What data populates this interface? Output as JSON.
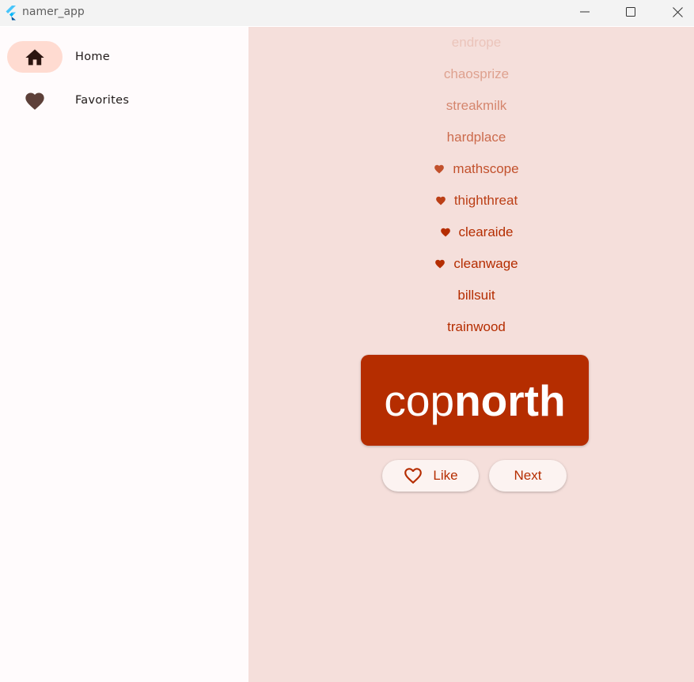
{
  "window": {
    "title": "namer_app",
    "icons": {
      "logo": "flutter-logo-icon",
      "minimize": "minimize-icon",
      "maximize": "maximize-icon",
      "close": "close-icon"
    }
  },
  "sidebar": {
    "items": [
      {
        "label": "Home",
        "icon": "home-icon",
        "selected": true
      },
      {
        "label": "Favorites",
        "icon": "heart-icon",
        "selected": false
      }
    ]
  },
  "history": [
    {
      "word": "endrope",
      "favorite": false
    },
    {
      "word": "chaosprize",
      "favorite": false
    },
    {
      "word": "streakmilk",
      "favorite": false
    },
    {
      "word": "hardplace",
      "favorite": false
    },
    {
      "word": "mathscope",
      "favorite": true
    },
    {
      "word": "thighthreat",
      "favorite": true
    },
    {
      "word": "clearaide",
      "favorite": true
    },
    {
      "word": "cleanwage",
      "favorite": true
    },
    {
      "word": "billsuit",
      "favorite": false
    },
    {
      "word": "trainwood",
      "favorite": false
    }
  ],
  "current_pair": {
    "first": "cop",
    "second": "north"
  },
  "buttons": {
    "like_label": "Like",
    "next_label": "Next"
  },
  "colors": {
    "primary": "#b52d00",
    "nav_indicator": "#ffdbd1",
    "main_background": "#f5dfdb",
    "sidebar_background": "#fffbfc",
    "button_background": "#fcf3f1"
  }
}
